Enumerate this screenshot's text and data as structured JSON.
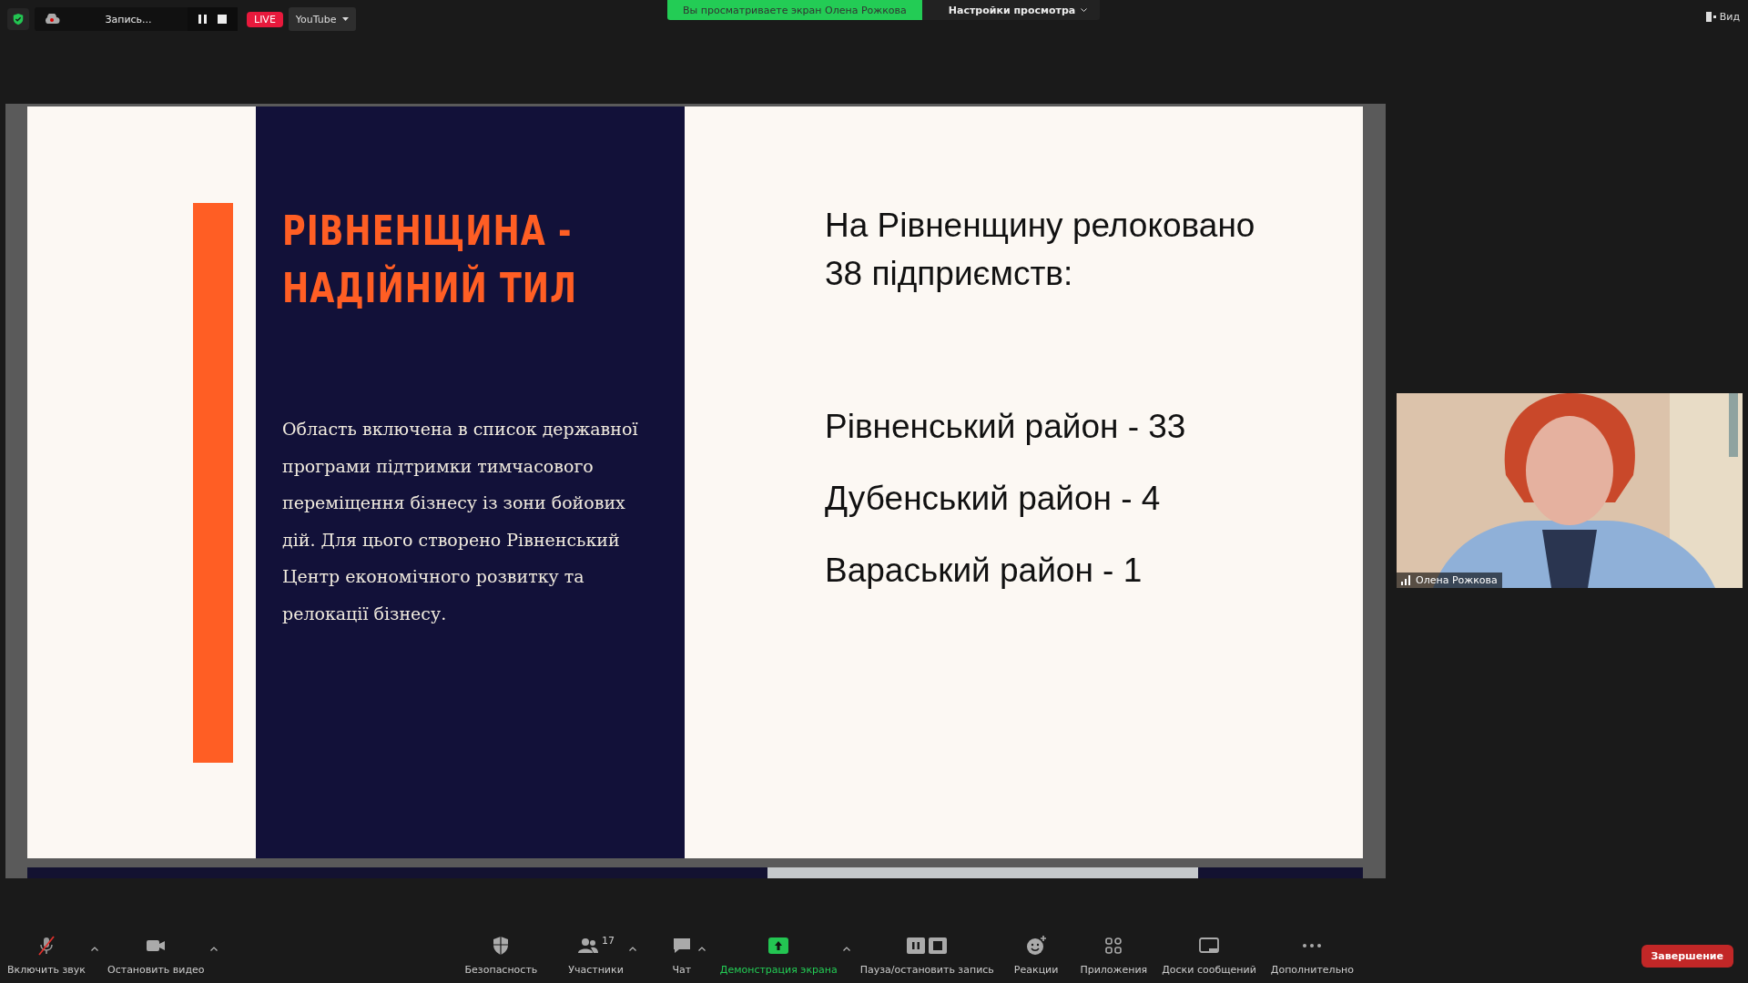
{
  "top_bar": {
    "recording": {
      "label": "Запись...",
      "live": "LIVE",
      "stream": "YouTube"
    },
    "banner": "Вы просматриваете экран Олена Рожкова",
    "view_options": "Настройки просмотра",
    "view": "Вид"
  },
  "slide": {
    "title": [
      "РІВНЕНЩИНА -",
      "НАДІЙНИЙ ТИЛ"
    ],
    "body": "Область включена в список державної програми підтримки тимчасового переміщення бізнесу із зони бойових дій. Для цього створено Рівненський Центр економічного розвитку та релокації бізнесу.",
    "heading": "На Рівненщину релоковано 38 підприємств:",
    "districts": [
      "Рівненський район - 33",
      "Дубенський район - 4",
      "Вараський район - 1"
    ]
  },
  "video_tile": {
    "kind": "picture",
    "name": "Олена Рожкова"
  },
  "toolbar": [
    {
      "kind": "mic",
      "label": "Включить звук",
      "menu": true,
      "highlighted": false
    },
    {
      "kind": "camera",
      "label": "Остановить видео",
      "menu": true,
      "highlighted": false
    },
    {
      "kind": "shield",
      "label": "Безопасность",
      "menu": false,
      "highlighted": false
    },
    {
      "kind": "people",
      "label": "Участники",
      "count": "17",
      "menu": true,
      "highlighted": false
    },
    {
      "kind": "chat",
      "label": "Чат",
      "menu": true,
      "highlighted": false
    },
    {
      "kind": "share",
      "label": "Демонстрация экрана",
      "menu": true,
      "highlighted": true
    },
    {
      "kind": "record",
      "label": "Пауза/остановить запись",
      "menu": false,
      "highlighted": false
    },
    {
      "kind": "reactions",
      "label": "Реакции",
      "menu": false,
      "highlighted": false
    },
    {
      "kind": "apps",
      "label": "Приложения",
      "menu": false,
      "highlighted": false
    },
    {
      "kind": "whiteboard",
      "label": "Доски сообщений",
      "menu": false,
      "highlighted": false
    },
    {
      "kind": "more",
      "label": "Дополнительно",
      "menu": false,
      "highlighted": false
    }
  ],
  "end_button": "Завершение"
}
